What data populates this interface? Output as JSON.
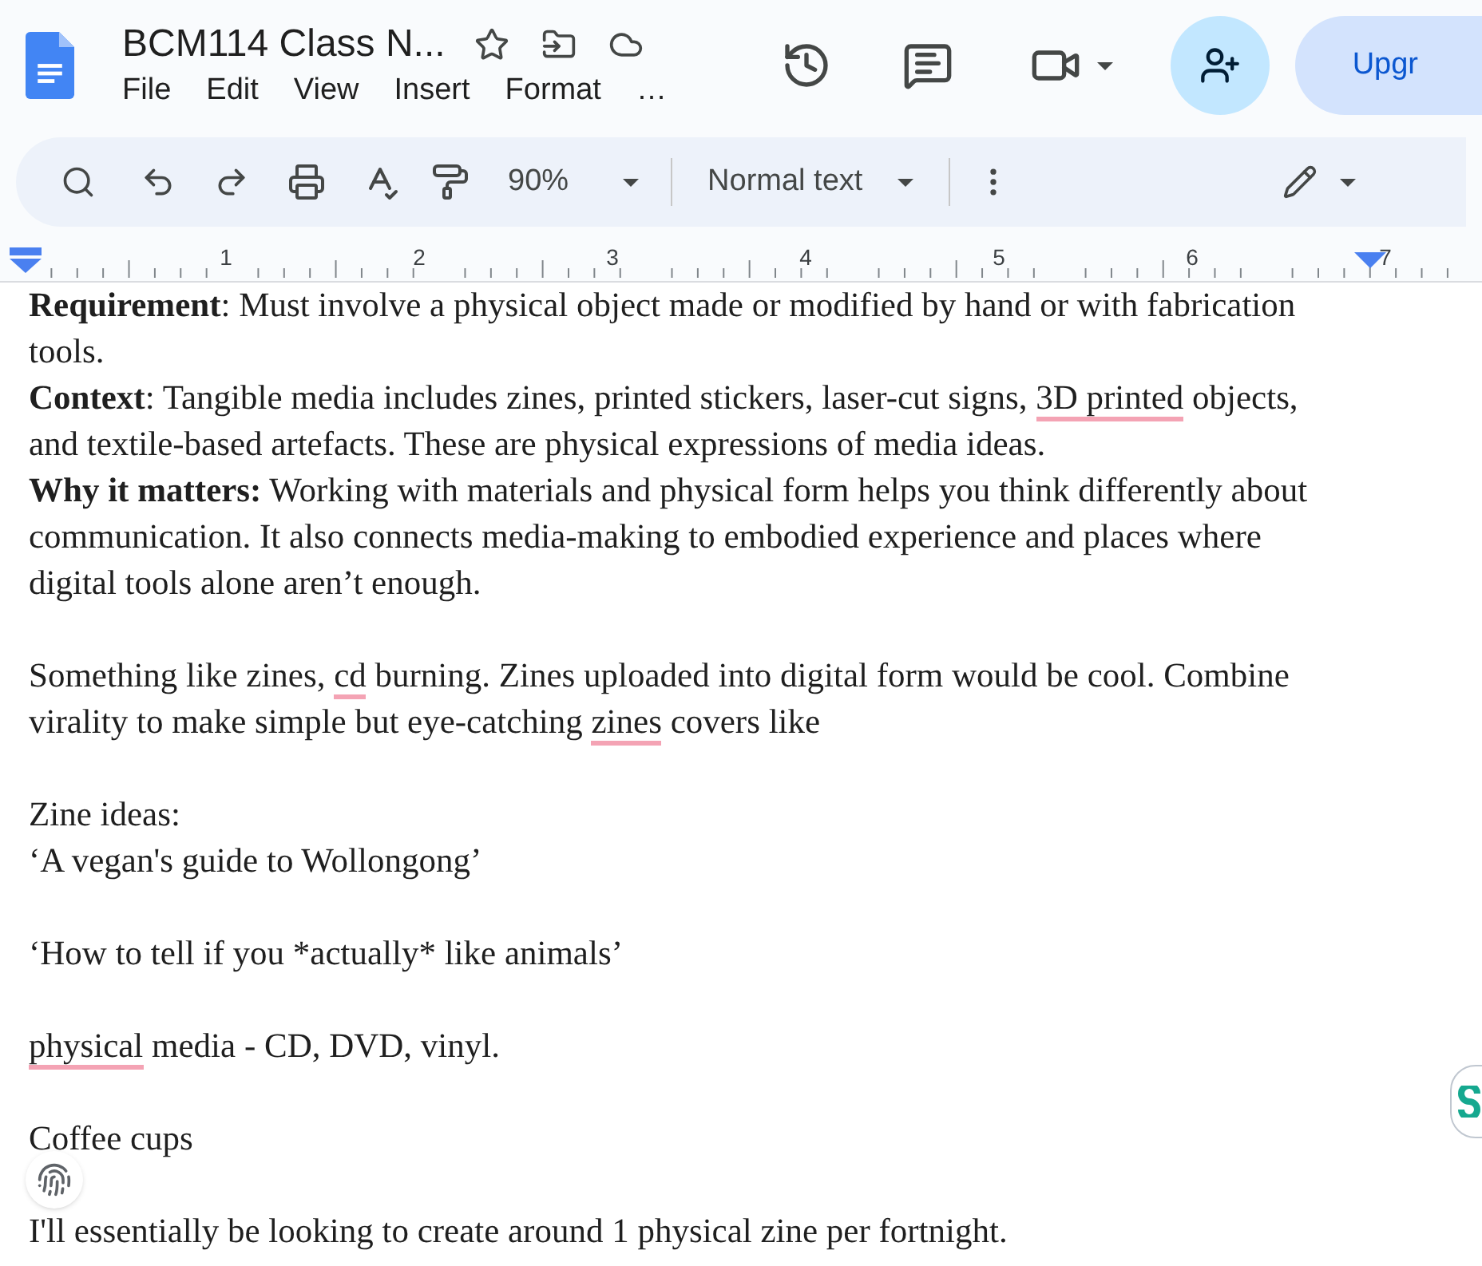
{
  "header": {
    "title": "BCM114 Class N...",
    "menu": [
      "File",
      "Edit",
      "View",
      "Insert",
      "Format",
      "…"
    ],
    "upgrade_button": "Upgr"
  },
  "toolbar": {
    "zoom": "90%",
    "style": "Normal text"
  },
  "ruler": {
    "numbers": [
      "1",
      "2",
      "3",
      "4",
      "5",
      "6",
      "7"
    ]
  },
  "document": {
    "blocks": [
      [
        [
          {
            "text": "Requirement",
            "bold": true,
            "flagged": false
          },
          {
            "text": ": Must involve a physical object made or modified by hand or with fabrication tools.",
            "bold": false,
            "flagged": false
          }
        ],
        [
          {
            "text": "Context",
            "bold": true,
            "flagged": false
          },
          {
            "text": ": Tangible media includes zines, printed stickers, laser-cut signs, ",
            "bold": false,
            "flagged": false
          },
          {
            "text": "3D printed",
            "bold": false,
            "flagged": true
          },
          {
            "text": " objects, and textile-based artefacts. These are physical expressions of media ideas.",
            "bold": false,
            "flagged": false
          }
        ],
        [
          {
            "text": "Why it matters:",
            "bold": true,
            "flagged": false
          },
          {
            "text": " Working with materials and physical form helps you think differently about communication. It also connects media-making to embodied experience and places where digital tools alone aren’t enough.",
            "bold": false,
            "flagged": false
          }
        ]
      ],
      [
        [
          {
            "text": "Something like zines, ",
            "bold": false,
            "flagged": false
          },
          {
            "text": "cd",
            "bold": false,
            "flagged": true
          },
          {
            "text": " burning. Zines uploaded into digital form would be cool. Combine virality to make simple but eye-catching ",
            "bold": false,
            "flagged": false
          },
          {
            "text": "zines",
            "bold": false,
            "flagged": true
          },
          {
            "text": " covers like",
            "bold": false,
            "flagged": false
          }
        ]
      ],
      [
        [
          {
            "text": "Zine ideas:",
            "bold": false,
            "flagged": false
          }
        ],
        [
          {
            "text": "‘A vegan's guide to Wollongong’",
            "bold": false,
            "flagged": false
          }
        ]
      ],
      [
        [
          {
            "text": "‘How to tell if you *actually* like animals’",
            "bold": false,
            "flagged": false
          }
        ]
      ],
      [
        [
          {
            "text": "physical",
            "bold": false,
            "flagged": true
          },
          {
            "text": " media - CD, DVD, vinyl.",
            "bold": false,
            "flagged": false
          }
        ]
      ],
      [
        [
          {
            "text": "Coffee cups",
            "bold": false,
            "flagged": false
          }
        ]
      ],
      [
        [
          {
            "text": "I'll essentially be looking to create around 1 physical zine per fortnight.",
            "bold": false,
            "flagged": false
          }
        ]
      ]
    ]
  }
}
